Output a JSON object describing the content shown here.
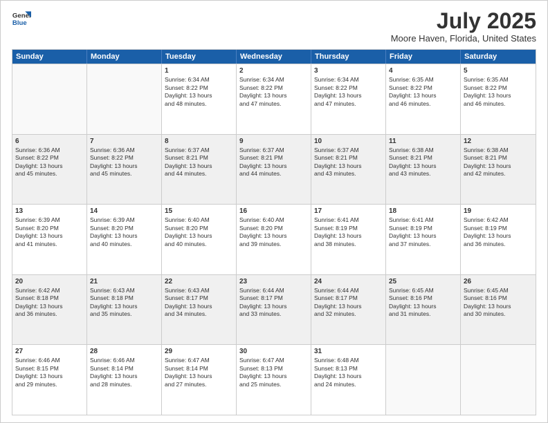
{
  "header": {
    "logo_general": "General",
    "logo_blue": "Blue",
    "title": "July 2025",
    "subtitle": "Moore Haven, Florida, United States"
  },
  "calendar": {
    "days_of_week": [
      "Sunday",
      "Monday",
      "Tuesday",
      "Wednesday",
      "Thursday",
      "Friday",
      "Saturday"
    ],
    "rows": [
      [
        {
          "day": "",
          "info": "",
          "empty": true
        },
        {
          "day": "",
          "info": "",
          "empty": true
        },
        {
          "day": "1",
          "info": "Sunrise: 6:34 AM\nSunset: 8:22 PM\nDaylight: 13 hours\nand 48 minutes."
        },
        {
          "day": "2",
          "info": "Sunrise: 6:34 AM\nSunset: 8:22 PM\nDaylight: 13 hours\nand 47 minutes."
        },
        {
          "day": "3",
          "info": "Sunrise: 6:34 AM\nSunset: 8:22 PM\nDaylight: 13 hours\nand 47 minutes."
        },
        {
          "day": "4",
          "info": "Sunrise: 6:35 AM\nSunset: 8:22 PM\nDaylight: 13 hours\nand 46 minutes."
        },
        {
          "day": "5",
          "info": "Sunrise: 6:35 AM\nSunset: 8:22 PM\nDaylight: 13 hours\nand 46 minutes."
        }
      ],
      [
        {
          "day": "6",
          "info": "Sunrise: 6:36 AM\nSunset: 8:22 PM\nDaylight: 13 hours\nand 45 minutes.",
          "shaded": true
        },
        {
          "day": "7",
          "info": "Sunrise: 6:36 AM\nSunset: 8:22 PM\nDaylight: 13 hours\nand 45 minutes.",
          "shaded": true
        },
        {
          "day": "8",
          "info": "Sunrise: 6:37 AM\nSunset: 8:21 PM\nDaylight: 13 hours\nand 44 minutes.",
          "shaded": true
        },
        {
          "day": "9",
          "info": "Sunrise: 6:37 AM\nSunset: 8:21 PM\nDaylight: 13 hours\nand 44 minutes.",
          "shaded": true
        },
        {
          "day": "10",
          "info": "Sunrise: 6:37 AM\nSunset: 8:21 PM\nDaylight: 13 hours\nand 43 minutes.",
          "shaded": true
        },
        {
          "day": "11",
          "info": "Sunrise: 6:38 AM\nSunset: 8:21 PM\nDaylight: 13 hours\nand 43 minutes.",
          "shaded": true
        },
        {
          "day": "12",
          "info": "Sunrise: 6:38 AM\nSunset: 8:21 PM\nDaylight: 13 hours\nand 42 minutes.",
          "shaded": true
        }
      ],
      [
        {
          "day": "13",
          "info": "Sunrise: 6:39 AM\nSunset: 8:20 PM\nDaylight: 13 hours\nand 41 minutes."
        },
        {
          "day": "14",
          "info": "Sunrise: 6:39 AM\nSunset: 8:20 PM\nDaylight: 13 hours\nand 40 minutes."
        },
        {
          "day": "15",
          "info": "Sunrise: 6:40 AM\nSunset: 8:20 PM\nDaylight: 13 hours\nand 40 minutes."
        },
        {
          "day": "16",
          "info": "Sunrise: 6:40 AM\nSunset: 8:20 PM\nDaylight: 13 hours\nand 39 minutes."
        },
        {
          "day": "17",
          "info": "Sunrise: 6:41 AM\nSunset: 8:19 PM\nDaylight: 13 hours\nand 38 minutes."
        },
        {
          "day": "18",
          "info": "Sunrise: 6:41 AM\nSunset: 8:19 PM\nDaylight: 13 hours\nand 37 minutes."
        },
        {
          "day": "19",
          "info": "Sunrise: 6:42 AM\nSunset: 8:19 PM\nDaylight: 13 hours\nand 36 minutes."
        }
      ],
      [
        {
          "day": "20",
          "info": "Sunrise: 6:42 AM\nSunset: 8:18 PM\nDaylight: 13 hours\nand 36 minutes.",
          "shaded": true
        },
        {
          "day": "21",
          "info": "Sunrise: 6:43 AM\nSunset: 8:18 PM\nDaylight: 13 hours\nand 35 minutes.",
          "shaded": true
        },
        {
          "day": "22",
          "info": "Sunrise: 6:43 AM\nSunset: 8:17 PM\nDaylight: 13 hours\nand 34 minutes.",
          "shaded": true
        },
        {
          "day": "23",
          "info": "Sunrise: 6:44 AM\nSunset: 8:17 PM\nDaylight: 13 hours\nand 33 minutes.",
          "shaded": true
        },
        {
          "day": "24",
          "info": "Sunrise: 6:44 AM\nSunset: 8:17 PM\nDaylight: 13 hours\nand 32 minutes.",
          "shaded": true
        },
        {
          "day": "25",
          "info": "Sunrise: 6:45 AM\nSunset: 8:16 PM\nDaylight: 13 hours\nand 31 minutes.",
          "shaded": true
        },
        {
          "day": "26",
          "info": "Sunrise: 6:45 AM\nSunset: 8:16 PM\nDaylight: 13 hours\nand 30 minutes.",
          "shaded": true
        }
      ],
      [
        {
          "day": "27",
          "info": "Sunrise: 6:46 AM\nSunset: 8:15 PM\nDaylight: 13 hours\nand 29 minutes."
        },
        {
          "day": "28",
          "info": "Sunrise: 6:46 AM\nSunset: 8:14 PM\nDaylight: 13 hours\nand 28 minutes."
        },
        {
          "day": "29",
          "info": "Sunrise: 6:47 AM\nSunset: 8:14 PM\nDaylight: 13 hours\nand 27 minutes."
        },
        {
          "day": "30",
          "info": "Sunrise: 6:47 AM\nSunset: 8:13 PM\nDaylight: 13 hours\nand 25 minutes."
        },
        {
          "day": "31",
          "info": "Sunrise: 6:48 AM\nSunset: 8:13 PM\nDaylight: 13 hours\nand 24 minutes."
        },
        {
          "day": "",
          "info": "",
          "empty": true
        },
        {
          "day": "",
          "info": "",
          "empty": true
        }
      ]
    ]
  }
}
